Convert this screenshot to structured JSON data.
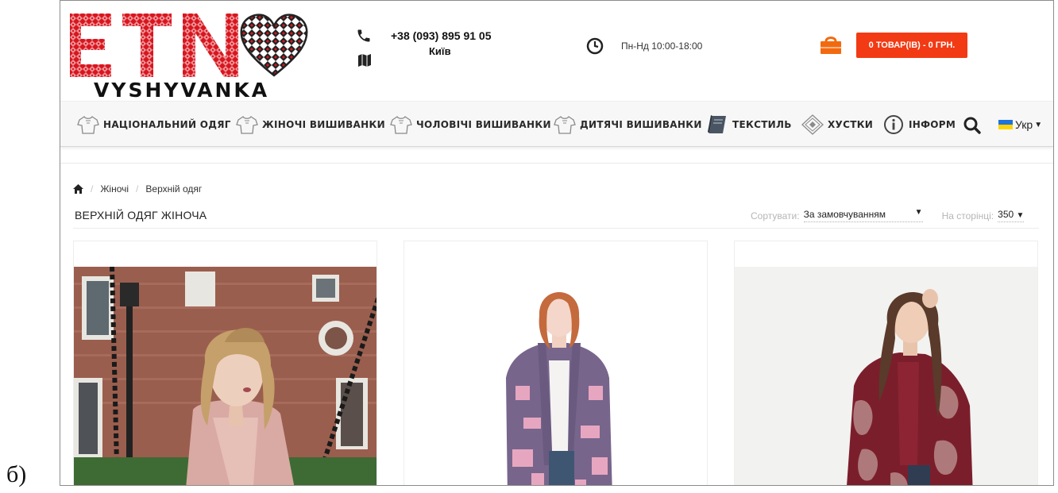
{
  "figure": {
    "label": "б)"
  },
  "header": {
    "logo": {
      "brand_text": "VYSHYVANKA",
      "word": "ETN"
    },
    "contact": {
      "phone": "+38 (093) 895 91 05",
      "city": "Київ"
    },
    "hours": "Пн-Нд 10:00-18:00",
    "cart": {
      "label": "0 ТОВАР(ІВ) - 0 ГРН."
    }
  },
  "nav": {
    "items": [
      {
        "label": "НАЦІОНАЛЬНИЙ ОДЯГ",
        "icon": "shirt-icon"
      },
      {
        "label": "ЖІНОЧІ ВИШИВАНКИ",
        "icon": "shirt-icon"
      },
      {
        "label": "ЧОЛОВІЧІ ВИШИВАНКИ",
        "icon": "shirt-icon"
      },
      {
        "label": "ДИТЯЧІ ВИШИВАНКИ",
        "icon": "shirt-icon"
      },
      {
        "label": "ТЕКСТИЛЬ",
        "icon": "book-icon"
      },
      {
        "label": "ХУСТКИ",
        "icon": "scarf-icon"
      },
      {
        "label": "ІНФОРМ",
        "icon": "info-icon"
      }
    ],
    "language": "Укр"
  },
  "breadcrumb": {
    "items": [
      "Жіночі",
      "Верхній одяг"
    ]
  },
  "page": {
    "title": "ВЕРХНІЙ ОДЯГ ЖІНОЧА"
  },
  "sort": {
    "label": "Сортувати:",
    "value": "За замовчуванням",
    "per_page_label": "На сторінці:",
    "per_page_value": "350"
  },
  "products": [
    {
      "image": "woman-pink-coat-photo"
    },
    {
      "image": "woman-lilac-cardigan-photo"
    },
    {
      "image": "woman-burgundy-cardigan-photo"
    }
  ],
  "colors": {
    "accent": "#f23a14",
    "logo_red": "#d9161f",
    "nav_bg": "#f7f7f7"
  }
}
